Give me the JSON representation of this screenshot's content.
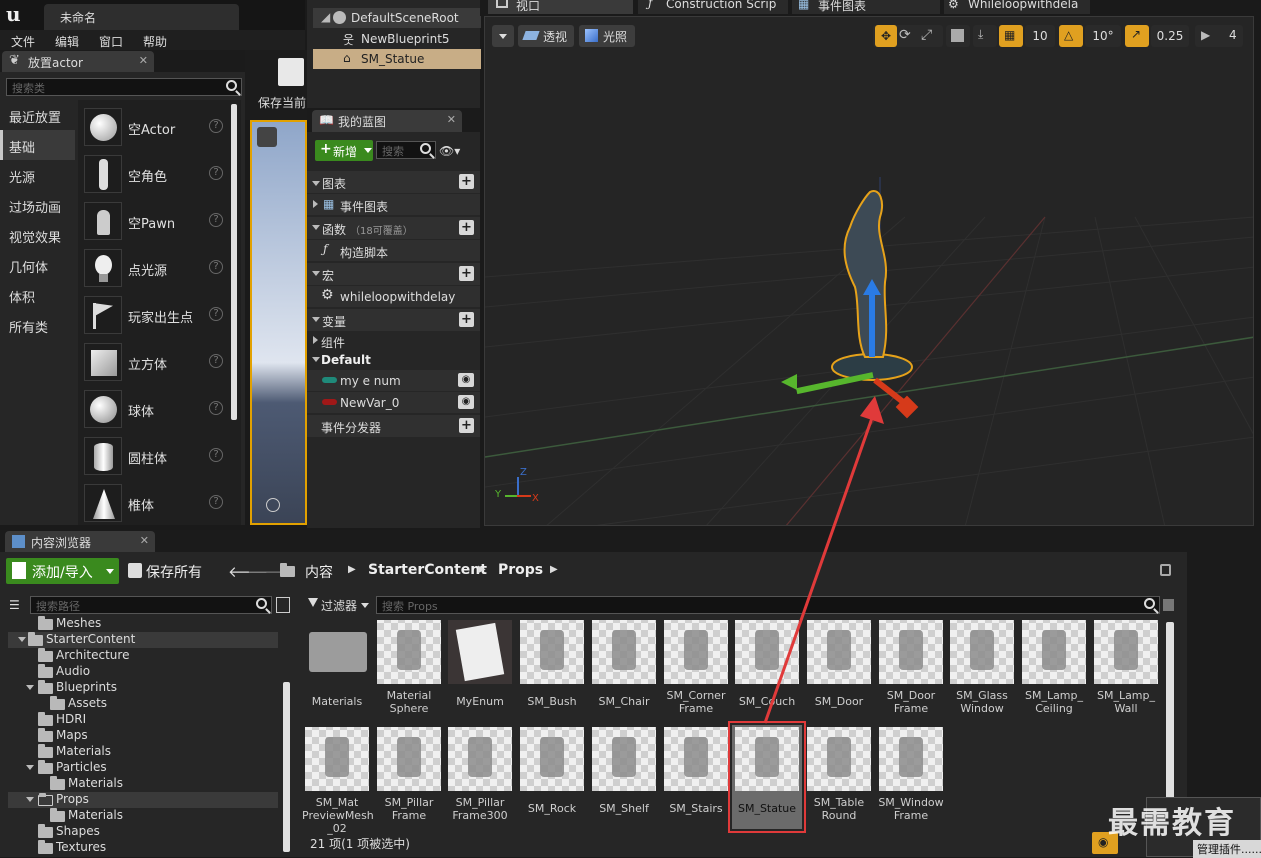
{
  "app": {
    "window_title": "未命名",
    "menu": [
      "文件",
      "编辑",
      "窗口",
      "帮助"
    ]
  },
  "place_actors": {
    "tab_label": "放置actor",
    "search_placeholder": "搜索类",
    "categories": [
      "最近放置",
      "基础",
      "光源",
      "过场动画",
      "视觉效果",
      "几何体",
      "体积",
      "所有类"
    ],
    "selected_category": "基础",
    "items": [
      "空Actor",
      "空角色",
      "空Pawn",
      "点光源",
      "玩家出生点",
      "立方体",
      "球体",
      "圆柱体",
      "椎体"
    ],
    "help_glyph": "?"
  },
  "toolbar": {
    "save_current_label": "保存当前"
  },
  "components": {
    "items": [
      "DefaultSceneRoot",
      "NewBlueprint5",
      "SM_Statue"
    ],
    "selected": "SM_Statue"
  },
  "my_blueprint": {
    "tab_label": "我的蓝图",
    "new_label": "新增",
    "search_placeholder": "搜索",
    "sections": {
      "graphs": "图表",
      "event_graph": "事件图表",
      "functions": "函数",
      "functions_override": "（18可覆盖）",
      "construction_script": "构造脚本",
      "macros": "宏",
      "macro_item": "whileloopwithdelay",
      "variables": "变量",
      "components": "组件",
      "default": "Default",
      "var1": "my e num",
      "var2": "NewVar_0",
      "dispatchers": "事件分发器"
    },
    "colors": {
      "var1": "#1f8a7a",
      "var2": "#a01818",
      "accent_green": "#3a8a1e"
    }
  },
  "editor_tabs": [
    "视口",
    "Construction Scrip",
    "事件图表",
    "Whileloopwithdela"
  ],
  "viewport": {
    "perspective_label": "透视",
    "lit_label": "光照",
    "grid_snap": "10",
    "rotation_snap": "10°",
    "scale_snap": "0.25",
    "camera_speed": "4",
    "axis_x": "X",
    "axis_y": "Y",
    "axis_z": "Z"
  },
  "content_browser": {
    "tab_label": "内容浏览器",
    "add_import_label": "添加/导入",
    "save_all_label": "保存所有",
    "breadcrumb": [
      "内容",
      "StarterContent",
      "Props"
    ],
    "path_search_placeholder": "搜索路径",
    "filters_label": "过滤器",
    "asset_search_placeholder": "搜索 Props",
    "tree": [
      {
        "label": "Meshes",
        "indent": 2
      },
      {
        "label": "StarterContent",
        "indent": 1,
        "expanded": true
      },
      {
        "label": "Architecture",
        "indent": 2
      },
      {
        "label": "Audio",
        "indent": 2
      },
      {
        "label": "Blueprints",
        "indent": 2,
        "expanded": true
      },
      {
        "label": "Assets",
        "indent": 3
      },
      {
        "label": "HDRI",
        "indent": 2
      },
      {
        "label": "Maps",
        "indent": 2
      },
      {
        "label": "Materials",
        "indent": 2
      },
      {
        "label": "Particles",
        "indent": 2,
        "expanded": true
      },
      {
        "label": "Materials",
        "indent": 3
      },
      {
        "label": "Props",
        "indent": 2,
        "expanded": true
      },
      {
        "label": "Materials",
        "indent": 3
      },
      {
        "label": "Shapes",
        "indent": 2
      },
      {
        "label": "Textures",
        "indent": 2
      }
    ],
    "assets_row1": [
      "Materials",
      "Material Sphere",
      "MyEnum",
      "SM_Bush",
      "SM_Chair",
      "SM_Corner Frame",
      "SM_Couch",
      "SM_Door",
      "SM_Door Frame",
      "SM_Glass Window",
      "SM_Lamp_ Ceiling",
      "SM_Lamp_ Wall"
    ],
    "assets_row2": [
      "SM_Mat PreviewMesh _02",
      "SM_Pillar Frame",
      "SM_Pillar Frame300",
      "SM_Rock",
      "SM_Shelf",
      "SM_Stairs",
      "SM_Statue",
      "SM_Table Round",
      "SM_Window Frame"
    ],
    "selected_asset": "SM_Statue",
    "status": "21 项(1 项被选中)"
  },
  "watermark": "最需教育",
  "plugin_popup": "管理插件......",
  "accent_highlight": "#e03a3a",
  "selection_color": "#c8ad86"
}
